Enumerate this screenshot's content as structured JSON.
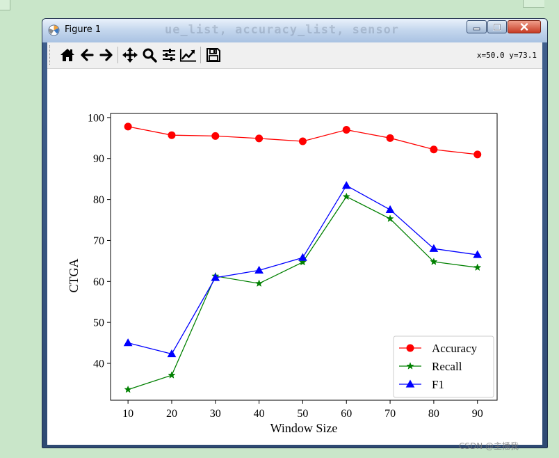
{
  "window": {
    "title": "Figure 1",
    "ghost_title": "ue_list, accuracy_list, sensor"
  },
  "toolbar": {
    "buttons": [
      {
        "name": "home-button",
        "icon": "home-icon"
      },
      {
        "name": "back-button",
        "icon": "arrow-left-icon"
      },
      {
        "name": "forward-button",
        "icon": "arrow-right-icon"
      },
      {
        "name": "pan-button",
        "icon": "move-icon"
      },
      {
        "name": "zoom-button",
        "icon": "magnifier-icon"
      },
      {
        "name": "subplots-button",
        "icon": "sliders-icon"
      },
      {
        "name": "edit-axis-button",
        "icon": "line-chart-icon"
      },
      {
        "name": "save-button",
        "icon": "floppy-disk-icon"
      }
    ],
    "coords": "x=50.0 y=73.1"
  },
  "watermark": "CSDN @主播我",
  "chart_data": {
    "type": "line",
    "x": [
      10,
      20,
      30,
      40,
      50,
      60,
      70,
      80,
      90
    ],
    "xlabel": "Window Size",
    "ylabel": "CTGA",
    "xlim": [
      6,
      94.5
    ],
    "ylim": [
      31,
      101
    ],
    "xticks": [
      10,
      20,
      30,
      40,
      50,
      60,
      70,
      80,
      90
    ],
    "yticks": [
      40,
      50,
      60,
      70,
      80,
      90,
      100
    ],
    "legend_position": "lower-right",
    "series": [
      {
        "name": "Accuracy",
        "color": "#ff0000",
        "marker": "circle",
        "values": [
          97.8,
          95.7,
          95.5,
          94.9,
          94.2,
          97.0,
          95.0,
          92.2,
          91.0
        ]
      },
      {
        "name": "Recall",
        "color": "#008000",
        "marker": "star",
        "values": [
          33.6,
          37.1,
          61.3,
          59.5,
          64.7,
          80.7,
          75.3,
          64.8,
          63.4
        ]
      },
      {
        "name": "F1",
        "color": "#0000ff",
        "marker": "triangle",
        "values": [
          45.0,
          42.3,
          60.9,
          62.7,
          65.8,
          83.4,
          77.5,
          68.0,
          66.5
        ]
      }
    ]
  }
}
